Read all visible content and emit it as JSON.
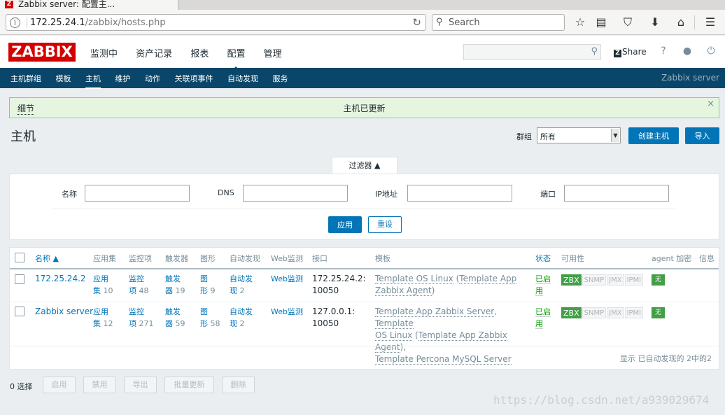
{
  "browser": {
    "tab_title": "Zabbix server: 配置主...",
    "url_host": "172.25.24.1",
    "url_path": "/zabbix/hosts.php",
    "search_placeholder": "Search"
  },
  "header": {
    "logo": "ZABBIX",
    "menu": [
      "监测中",
      "资产记录",
      "报表",
      "配置",
      "管理"
    ],
    "share": "Share",
    "help": "?"
  },
  "subnav": {
    "items": [
      "主机群组",
      "模板",
      "主机",
      "维护",
      "动作",
      "关联项事件",
      "自动发现",
      "服务"
    ],
    "server": "Zabbix server"
  },
  "message": {
    "details": "细节",
    "text": "主机已更新",
    "close": "×"
  },
  "page": {
    "title": "主机",
    "group_label": "群组",
    "group_value": "所有",
    "create_button": "创建主机",
    "import_button": "导入"
  },
  "filter": {
    "tab": "过滤器 ▲",
    "name_label": "名称",
    "dns_label": "DNS",
    "ip_label": "IP地址",
    "port_label": "端口",
    "apply": "应用",
    "reset": "重设"
  },
  "table": {
    "headers": {
      "name": "名称 ▲",
      "applications": "应用集",
      "items": "监控项",
      "triggers": "触发器",
      "graphs": "图形",
      "discovery": "自动发现",
      "web": "Web监测",
      "interface": "接口",
      "templates": "模板",
      "status": "状态",
      "availability": "可用性",
      "agent_encryption": "agent 加密",
      "info": "信息"
    },
    "rows": [
      {
        "name": "172.25.24.2",
        "apps_l1": "应用",
        "apps_l2": "集",
        "apps_count": "10",
        "items_l1": "监控",
        "items_l2": "项",
        "items_count": "48",
        "triggers_l1": "触发",
        "triggers_l2": "器",
        "triggers_count": "19",
        "graphs_l1": "图",
        "graphs_l2": "形",
        "graphs_count": "9",
        "disc_l1": "自动发",
        "disc_l2": "现",
        "disc_count": "2",
        "web": "Web监测",
        "iface_l1": "172.25.24.2:",
        "iface_l2": "10050",
        "tpl_1": "Template OS Linux",
        "tpl_p1": " (",
        "tpl_2": "Template App",
        "tpl_3": "Zabbix Agent",
        "tpl_p2": ")",
        "status_l1": "已启",
        "status_l2": "用",
        "zbx": "ZBX",
        "snmp": "SNMP",
        "jmx": "JMX",
        "ipmi": "IPMI",
        "encryption": "无"
      },
      {
        "name": "Zabbix server",
        "apps_l1": "应用",
        "apps_l2": "集",
        "apps_count": "12",
        "items_l1": "监控",
        "items_l2": "项",
        "items_count": "271",
        "triggers_l1": "触发",
        "triggers_l2": "器",
        "triggers_count": "59",
        "graphs_l1": "图",
        "graphs_l2": "形",
        "graphs_count": "58",
        "disc_l1": "自动发",
        "disc_l2": "现",
        "disc_count": "2",
        "web": "Web监测",
        "iface_l1": "127.0.0.1:",
        "iface_l2": "10050",
        "tpl_1": "Template App Zabbix Server",
        "tpl_c1": ", ",
        "tpl_2": "Template",
        "tpl_3": "OS Linux",
        "tpl_p1": " (",
        "tpl_4": "Template App Zabbix Agent",
        "tpl_p2": "),",
        "tpl_5": "Template Percona MySQL Server",
        "status_l1": "已启",
        "status_l2": "用",
        "zbx": "ZBX",
        "snmp": "SNMP",
        "jmx": "JMX",
        "ipmi": "IPMI",
        "encryption": "无"
      }
    ],
    "footer": "显示 已自动发现的 2中的2"
  },
  "bottom": {
    "selected": "0 选择",
    "buttons": [
      "启用",
      "禁用",
      "导出",
      "批量更新",
      "删除"
    ]
  },
  "watermark": "https://blog.csdn.net/a939029674",
  "colors": {
    "brand_red": "#d40000",
    "nav_blue": "#0a466a",
    "link_blue": "#0275b8",
    "ok_green": "#429e47"
  }
}
